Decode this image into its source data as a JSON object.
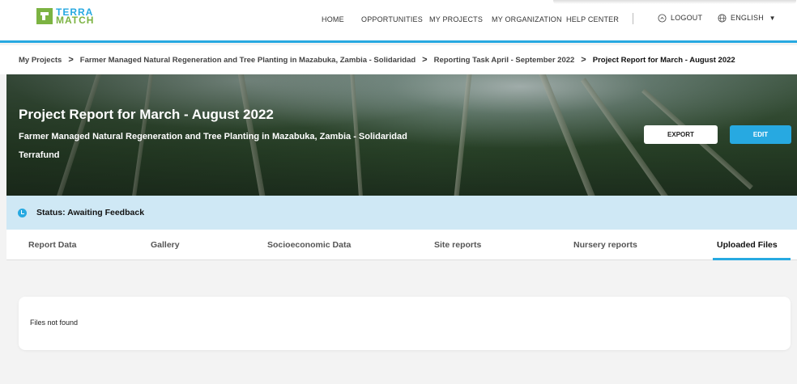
{
  "logo": {
    "line1": "TERRA",
    "line2": "MATCH"
  },
  "nav": {
    "home": "HOME",
    "opportunities": "OPPORTUNITIES",
    "my_projects": "MY PROJECTS",
    "my_organization": "MY ORGANIZATION",
    "help_center": "HELP CENTER",
    "logout": "LOGOUT",
    "language": "ENGLISH"
  },
  "breadcrumb": {
    "items": [
      "My Projects",
      "Farmer Managed Natural Regeneration and Tree Planting in Mazabuka, Zambia - Solidaridad",
      "Reporting Task April - September 2022",
      "Project Report for March - August 2022"
    ],
    "separator": ">"
  },
  "hero": {
    "title": "Project Report for March - August 2022",
    "project": "Farmer Managed Natural Regeneration and Tree Planting in Mazabuka, Zambia - Solidaridad",
    "fund": "Terrafund",
    "export_label": "EXPORT",
    "edit_label": "EDIT"
  },
  "status": {
    "text": "Status: Awaiting Feedback"
  },
  "tabs": [
    {
      "label": "Report Data"
    },
    {
      "label": "Gallery"
    },
    {
      "label": "Socioeconomic Data"
    },
    {
      "label": "Site reports"
    },
    {
      "label": "Nursery reports"
    },
    {
      "label": "Uploaded Files"
    }
  ],
  "content": {
    "empty_message": "Files not found"
  },
  "colors": {
    "accent": "#27a9e1",
    "brand_green": "#7cb342",
    "status_bg": "#cfe8f5"
  }
}
